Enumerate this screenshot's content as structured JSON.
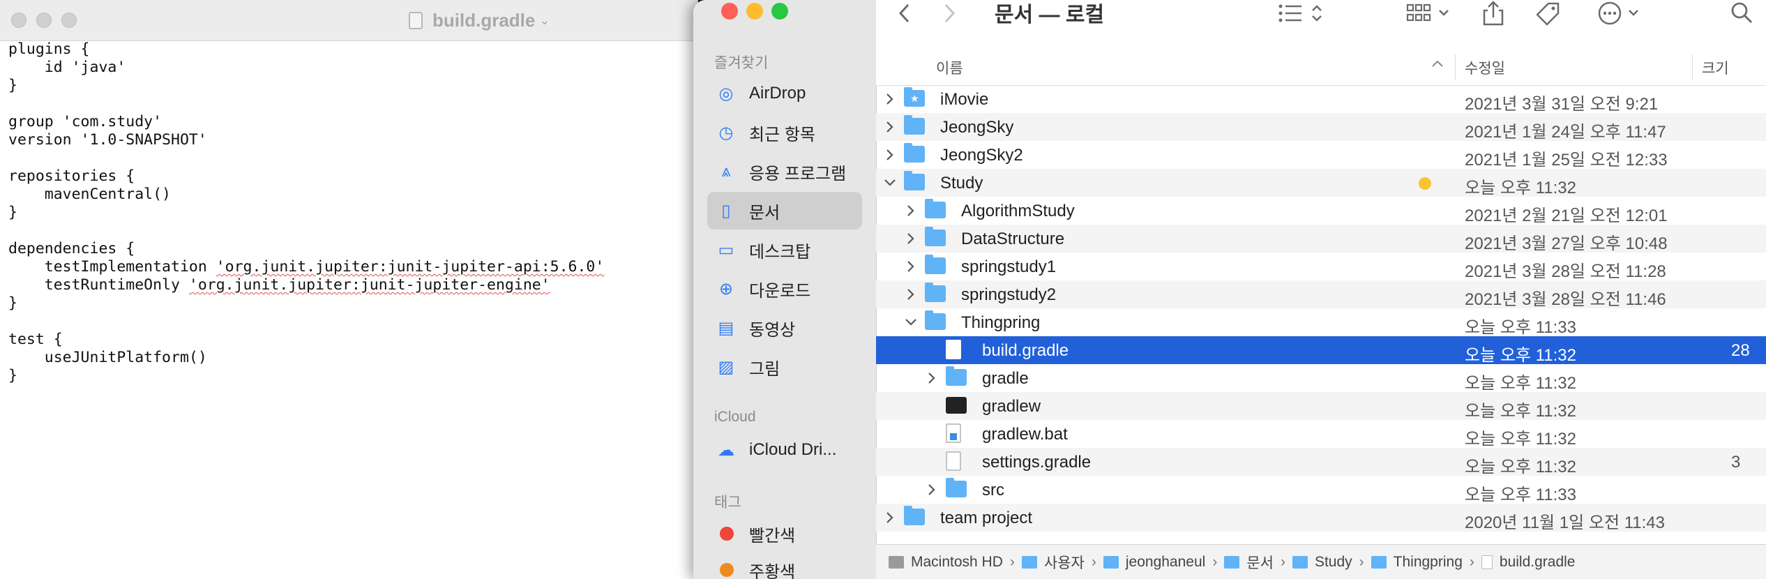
{
  "textedit": {
    "title": "build.gradle",
    "lines": [
      "plugins {",
      "    id 'java'",
      "}",
      "",
      "group 'com.study'",
      "version '1.0-SNAPSHOT'",
      "",
      "repositories {",
      "    mavenCentral()",
      "}",
      "",
      "dependencies {",
      "    testImplementation 'org.junit.jupiter:junit-jupiter-api:5.6.0'",
      "    testRuntimeOnly 'org.junit.jupiter:junit-jupiter-engine'",
      "}",
      "",
      "test {",
      "    useJUnitPlatform()",
      "}"
    ]
  },
  "finder": {
    "title": "문서 — 로컬",
    "sidebar": {
      "favorites_header": "즐겨찾기",
      "favorites": [
        {
          "label": "AirDrop",
          "icon": "airdrop-icon"
        },
        {
          "label": "최근 항목",
          "icon": "clock-icon"
        },
        {
          "label": "응용 프로그램",
          "icon": "applications-icon"
        },
        {
          "label": "문서",
          "icon": "document-icon"
        },
        {
          "label": "데스크탑",
          "icon": "desktop-icon"
        },
        {
          "label": "다운로드",
          "icon": "download-icon"
        },
        {
          "label": "동영상",
          "icon": "movie-icon"
        },
        {
          "label": "그림",
          "icon": "picture-icon"
        }
      ],
      "icloud_header": "iCloud",
      "icloud": [
        {
          "label": "iCloud Dri...",
          "icon": "cloud-icon"
        }
      ],
      "tags_header": "태그",
      "tags": [
        {
          "label": "빨간색",
          "color": "#f0453a"
        },
        {
          "label": "주황색",
          "color": "#f08a1c"
        }
      ]
    },
    "columns": {
      "name": "이름",
      "modified": "수정일",
      "size": "크기"
    },
    "rows": [
      {
        "name": "iMovie",
        "date": "2021년 3월 31일 오전 9:21",
        "size": "",
        "type": "imovie",
        "indent": 0,
        "disclosure": "›"
      },
      {
        "name": "JeongSky",
        "date": "2021년 1월 24일 오후 11:47",
        "size": "",
        "type": "folder",
        "indent": 0,
        "disclosure": "›"
      },
      {
        "name": "JeongSky2",
        "date": "2021년 1월 25일 오전 12:33",
        "size": "",
        "type": "folder",
        "indent": 0,
        "disclosure": "›"
      },
      {
        "name": "Study",
        "date": "오늘 오후 11:32",
        "size": "",
        "type": "folder",
        "indent": 0,
        "disclosure": "⌄",
        "tag": "#f7c531"
      },
      {
        "name": "AlgorithmStudy",
        "date": "2021년 2월 21일 오전 12:01",
        "size": "",
        "type": "folder",
        "indent": 1,
        "disclosure": "›"
      },
      {
        "name": "DataStructure",
        "date": "2021년 3월 27일 오후 10:48",
        "size": "",
        "type": "folder",
        "indent": 1,
        "disclosure": "›"
      },
      {
        "name": "springstudy1",
        "date": "2021년 3월 28일 오전 11:28",
        "size": "",
        "type": "folder",
        "indent": 1,
        "disclosure": "›"
      },
      {
        "name": "springstudy2",
        "date": "2021년 3월 28일 오전 11:46",
        "size": "",
        "type": "folder",
        "indent": 1,
        "disclosure": "›"
      },
      {
        "name": "Thingpring",
        "date": "오늘 오후 11:33",
        "size": "",
        "type": "folder",
        "indent": 1,
        "disclosure": "⌄"
      },
      {
        "name": "build.gradle",
        "date": "오늘 오후 11:32",
        "size": "28",
        "type": "doc",
        "indent": 2,
        "disclosure": "",
        "selected": true
      },
      {
        "name": "gradle",
        "date": "오늘 오후 11:32",
        "size": "",
        "type": "folder",
        "indent": 2,
        "disclosure": "›"
      },
      {
        "name": "gradlew",
        "date": "오늘 오후 11:32",
        "size": "",
        "type": "terminal",
        "indent": 2,
        "disclosure": ""
      },
      {
        "name": "gradlew.bat",
        "date": "오늘 오후 11:32",
        "size": "",
        "type": "bat",
        "indent": 2,
        "disclosure": ""
      },
      {
        "name": "settings.gradle",
        "date": "오늘 오후 11:32",
        "size": "3",
        "type": "doc",
        "indent": 2,
        "disclosure": ""
      },
      {
        "name": "src",
        "date": "오늘 오후 11:33",
        "size": "",
        "type": "folder",
        "indent": 2,
        "disclosure": "›"
      },
      {
        "name": "team project",
        "date": "2020년 11월 1일 오전 11:43",
        "size": "",
        "type": "folder",
        "indent": 0,
        "disclosure": "›"
      }
    ],
    "pathbar": [
      {
        "label": "Macintosh HD",
        "type": "disk"
      },
      {
        "label": "사용자",
        "type": "folder"
      },
      {
        "label": "jeonghaneul",
        "type": "folder"
      },
      {
        "label": "문서",
        "type": "folder"
      },
      {
        "label": "Study",
        "type": "folder"
      },
      {
        "label": "Thingpring",
        "type": "folder"
      },
      {
        "label": "build.gradle",
        "type": "doc"
      }
    ],
    "colors": {
      "selection": "#2160d8",
      "accent": "#2d7cf6",
      "folder": "#5fb3f6"
    }
  }
}
